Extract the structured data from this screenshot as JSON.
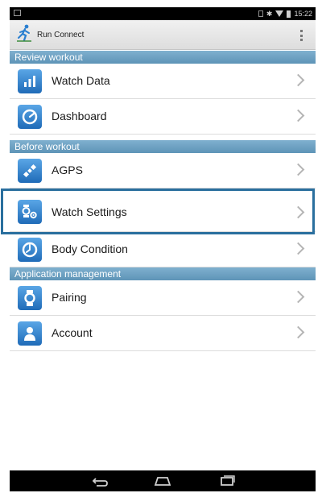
{
  "app": {
    "title": "Run Connect"
  },
  "status_bar": {
    "time": "15:22"
  },
  "sections": [
    {
      "title": "Review workout",
      "items": [
        {
          "label": "Watch Data",
          "icon": "bar-chart-icon"
        },
        {
          "label": "Dashboard",
          "icon": "gauge-icon"
        }
      ]
    },
    {
      "title": "Before workout",
      "items": [
        {
          "label": "AGPS",
          "icon": "satellite-icon"
        },
        {
          "label": "Watch Settings",
          "icon": "watch-gear-icon",
          "highlighted": true
        },
        {
          "label": "Body Condition",
          "icon": "body-condition-icon"
        }
      ]
    },
    {
      "title": "Application management",
      "items": [
        {
          "label": "Pairing",
          "icon": "watch-icon"
        },
        {
          "label": "Account",
          "icon": "person-icon"
        }
      ]
    }
  ],
  "colors": {
    "section_header": "#6aa0c2",
    "icon_blue": "#2f80cc",
    "highlight_border": "#2a6f9e"
  }
}
